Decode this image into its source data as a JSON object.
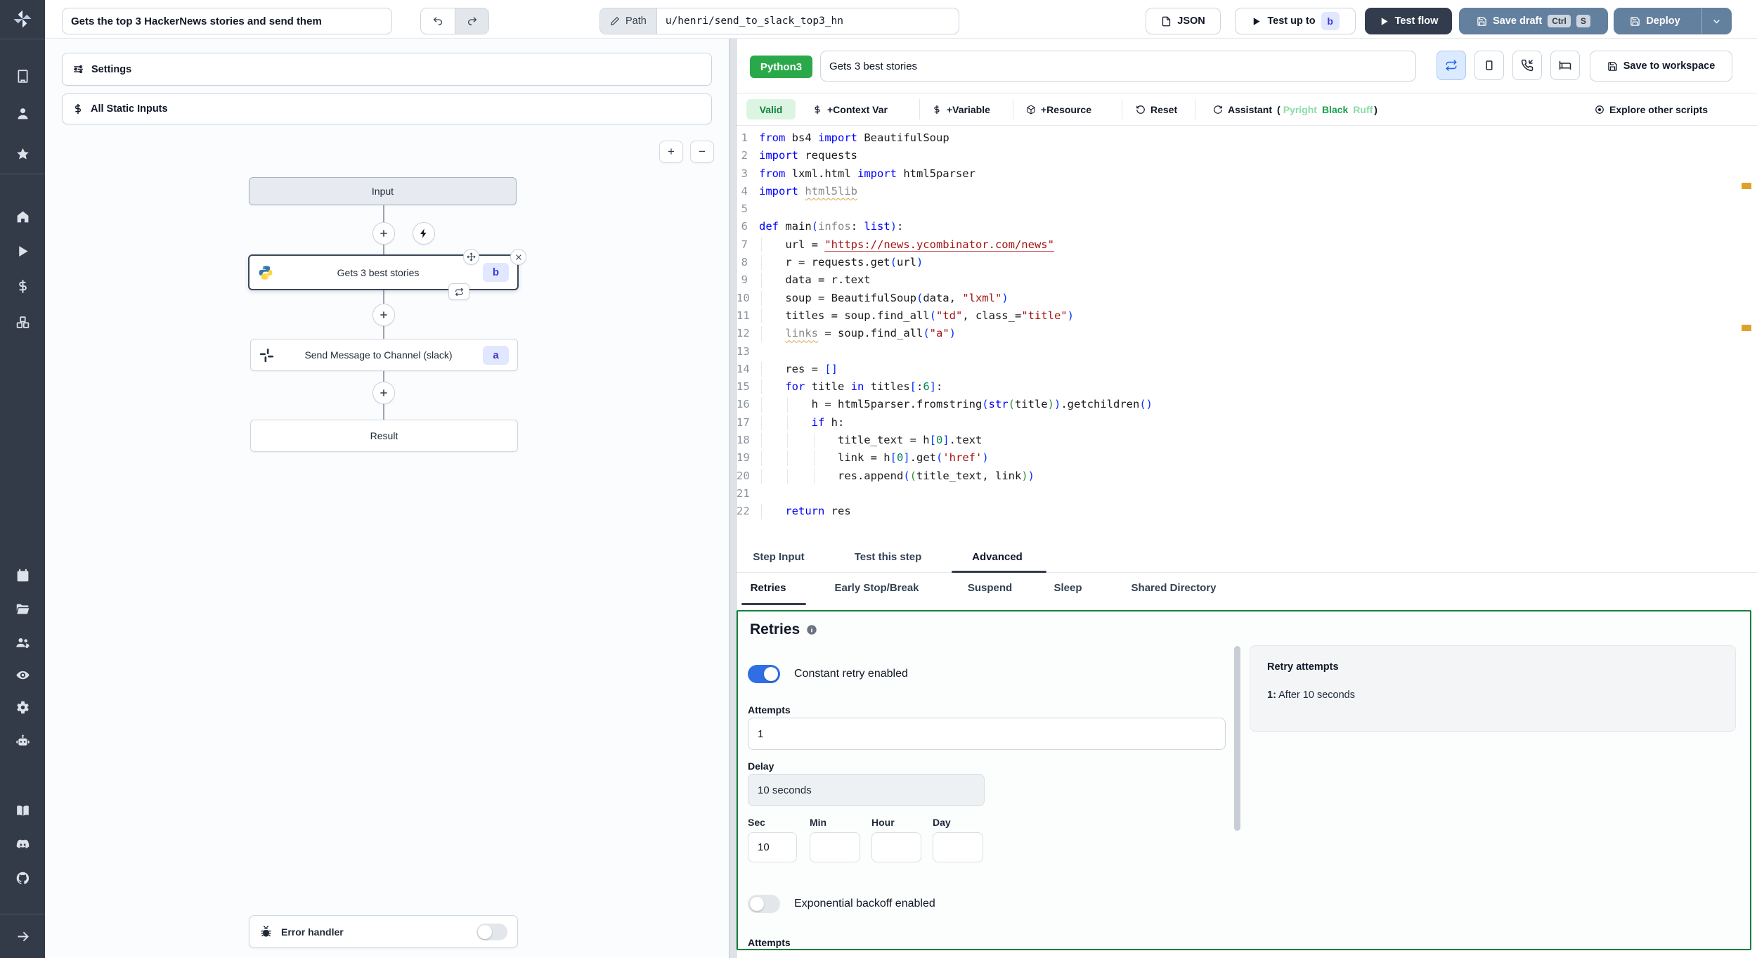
{
  "colors": {
    "sidebar_bg": "#333b49",
    "accent_blue_button": "#64809f",
    "dark_button": "#333c4d",
    "python_badge_green": "#2aa94a",
    "valid_badge_green": "#15803d",
    "panel_border_green": "#15803d",
    "toggle_on_blue": "#2f6fe3",
    "step_badge_bg": "#e0e7ff",
    "step_badge_text": "#4338ca",
    "warning_marker_orange": "#dca32b"
  },
  "sidebar": {
    "icons": [
      "windmill-logo",
      "workspace-building",
      "user",
      "favorites-star",
      "home",
      "runs-play",
      "variables-dollar",
      "resources-boxes",
      "schedules-calendar",
      "folders",
      "groups-users",
      "audit-eye",
      "settings-gear",
      "ai-bot",
      "docs-book",
      "discord",
      "github",
      "collapse-arrow"
    ]
  },
  "topbar": {
    "flow_title": "Gets the top 3 HackerNews stories and send them",
    "path_label": "Path",
    "path_value": "u/henri/send_to_slack_top3_hn",
    "json_button": "JSON",
    "test_up_to": "Test up to",
    "test_up_to_badge": "b",
    "test_flow": "Test flow",
    "save_draft": "Save draft",
    "save_draft_kbd1": "Ctrl",
    "save_draft_kbd2": "S",
    "deploy": "Deploy"
  },
  "flow_panel": {
    "settings": "Settings",
    "all_static_inputs": "All Static Inputs",
    "zoom_in": "+",
    "zoom_out": "−",
    "nodes": {
      "input_label": "Input",
      "step_b_label": "Gets 3 best stories",
      "step_b_badge": "b",
      "step_a_label": "Send Message to Channel (slack)",
      "step_a_badge": "a",
      "result_label": "Result",
      "error_handler_label": "Error handler"
    }
  },
  "editor": {
    "lang_badge": "Python3",
    "step_name": "Gets 3 best stories",
    "save_to_workspace": "Save to workspace",
    "toolbar": {
      "valid": "Valid",
      "context_var": "+Context Var",
      "variable": "+Variable",
      "resource": "+Resource",
      "reset": "Reset",
      "assistant": "Assistant",
      "paren_open": "(",
      "assistant_pyright": "Pyright",
      "assistant_black": "Black",
      "assistant_ruff": "Ruff",
      "paren_close": ")",
      "explore": "Explore other scripts"
    },
    "code": {
      "lines": [
        [
          {
            "c": "kw",
            "t": "from"
          },
          {
            "c": "t",
            "t": " bs4 "
          },
          {
            "c": "kw",
            "t": "import"
          },
          {
            "c": "t",
            "t": " BeautifulSoup"
          }
        ],
        [
          {
            "c": "kw",
            "t": "import"
          },
          {
            "c": "t",
            "t": " requests"
          }
        ],
        [
          {
            "c": "kw",
            "t": "from"
          },
          {
            "c": "t",
            "t": " lxml.html "
          },
          {
            "c": "kw",
            "t": "import"
          },
          {
            "c": "t",
            "t": " html5parser"
          }
        ],
        [
          {
            "c": "kw",
            "t": "import"
          },
          {
            "c": "t",
            "t": " "
          },
          {
            "c": "grq",
            "t": "html5lib"
          }
        ],
        [],
        [
          {
            "c": "kw",
            "t": "def"
          },
          {
            "c": "t",
            "t": " main"
          },
          {
            "c": "b1",
            "t": "("
          },
          {
            "c": "gr",
            "t": "infos"
          },
          {
            "c": "t",
            "t": ": "
          },
          {
            "c": "kw",
            "t": "list"
          },
          {
            "c": "b1",
            "t": ")"
          },
          {
            "c": "t",
            "t": ":"
          }
        ],
        [
          {
            "c": "t",
            "t": "    url = "
          },
          {
            "c": "stru",
            "t": "\"https://news.ycombinator.com/news\""
          }
        ],
        [
          {
            "c": "t",
            "t": "    r = requests.get"
          },
          {
            "c": "b1",
            "t": "("
          },
          {
            "c": "t",
            "t": "url"
          },
          {
            "c": "b1",
            "t": ")"
          }
        ],
        [
          {
            "c": "t",
            "t": "    data = r.text"
          }
        ],
        [
          {
            "c": "t",
            "t": "    soup = BeautifulSoup"
          },
          {
            "c": "b1",
            "t": "("
          },
          {
            "c": "t",
            "t": "data, "
          },
          {
            "c": "str",
            "t": "\"lxml\""
          },
          {
            "c": "b1",
            "t": ")"
          }
        ],
        [
          {
            "c": "t",
            "t": "    titles = soup.find_all"
          },
          {
            "c": "b1",
            "t": "("
          },
          {
            "c": "str",
            "t": "\"td\""
          },
          {
            "c": "t",
            "t": ", class_="
          },
          {
            "c": "str",
            "t": "\"title\""
          },
          {
            "c": "b1",
            "t": ")"
          }
        ],
        [
          {
            "c": "t",
            "t": "    "
          },
          {
            "c": "grq",
            "t": "links"
          },
          {
            "c": "t",
            "t": " = soup.find_all"
          },
          {
            "c": "b1",
            "t": "("
          },
          {
            "c": "str",
            "t": "\"a\""
          },
          {
            "c": "b1",
            "t": ")"
          }
        ],
        [],
        [
          {
            "c": "t",
            "t": "    res = "
          },
          {
            "c": "b1",
            "t": "[]"
          }
        ],
        [
          {
            "c": "t",
            "t": "    "
          },
          {
            "c": "kw",
            "t": "for"
          },
          {
            "c": "t",
            "t": " title "
          },
          {
            "c": "kw",
            "t": "in"
          },
          {
            "c": "t",
            "t": " titles"
          },
          {
            "c": "b1",
            "t": "["
          },
          {
            "c": "t",
            "t": ":"
          },
          {
            "c": "num",
            "t": "6"
          },
          {
            "c": "b1",
            "t": "]"
          },
          {
            "c": "t",
            "t": ":"
          }
        ],
        [
          {
            "c": "t",
            "t": "        h = html5parser.fromstring"
          },
          {
            "c": "b1",
            "t": "("
          },
          {
            "c": "kw",
            "t": "str"
          },
          {
            "c": "b2",
            "t": "("
          },
          {
            "c": "t",
            "t": "title"
          },
          {
            "c": "b2",
            "t": ")"
          },
          {
            "c": "b1",
            "t": ")"
          },
          {
            "c": "t",
            "t": ".getchildren"
          },
          {
            "c": "b1",
            "t": "()"
          }
        ],
        [
          {
            "c": "t",
            "t": "        "
          },
          {
            "c": "kw",
            "t": "if"
          },
          {
            "c": "t",
            "t": " h:"
          }
        ],
        [
          {
            "c": "t",
            "t": "            title_text = h"
          },
          {
            "c": "b1",
            "t": "["
          },
          {
            "c": "num",
            "t": "0"
          },
          {
            "c": "b1",
            "t": "]"
          },
          {
            "c": "t",
            "t": ".text"
          }
        ],
        [
          {
            "c": "t",
            "t": "            link = h"
          },
          {
            "c": "b1",
            "t": "["
          },
          {
            "c": "num",
            "t": "0"
          },
          {
            "c": "b1",
            "t": "]"
          },
          {
            "c": "t",
            "t": ".get"
          },
          {
            "c": "b1",
            "t": "("
          },
          {
            "c": "str",
            "t": "'href'"
          },
          {
            "c": "b1",
            "t": ")"
          }
        ],
        [
          {
            "c": "t",
            "t": "            res.append"
          },
          {
            "c": "b1",
            "t": "("
          },
          {
            "c": "b2",
            "t": "("
          },
          {
            "c": "t",
            "t": "title_text, link"
          },
          {
            "c": "b2",
            "t": ")"
          },
          {
            "c": "b1",
            "t": ")"
          }
        ],
        [],
        [
          {
            "c": "t",
            "t": "    "
          },
          {
            "c": "kw",
            "t": "return"
          },
          {
            "c": "t",
            "t": " res"
          }
        ]
      ]
    }
  },
  "tabs": {
    "main": [
      "Step Input",
      "Test this step",
      "Advanced"
    ],
    "main_active": "Advanced",
    "sub": [
      "Retries",
      "Early Stop/Break",
      "Suspend",
      "Sleep",
      "Shared Directory"
    ],
    "sub_active": "Retries"
  },
  "retries": {
    "title": "Retries",
    "constant_toggle_label": "Constant retry enabled",
    "attempts_label": "Attempts",
    "attempts_value": "1",
    "delay_label": "Delay",
    "delay_value": "10 seconds",
    "sec_label": "Sec",
    "min_label": "Min",
    "hour_label": "Hour",
    "day_label": "Day",
    "sec_value": "10",
    "min_value": "",
    "hour_value": "",
    "day_value": "",
    "exponential_toggle_label": "Exponential backoff enabled",
    "attempts2_label": "Attempts",
    "summary_title": "Retry attempts",
    "summary_line_index": "1:",
    "summary_line_text": "After 10 seconds"
  }
}
